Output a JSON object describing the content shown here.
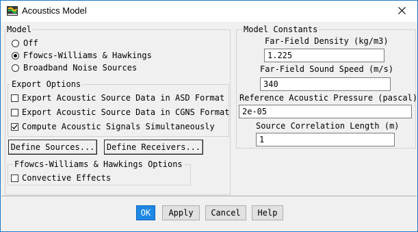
{
  "window": {
    "title": "Acoustics Model",
    "icon": "fluent-app-icon",
    "close_icon": "close-icon"
  },
  "model": {
    "label": "Model",
    "options": [
      {
        "label": "Off",
        "selected": false
      },
      {
        "label": "Ffowcs-Williams & Hawkings",
        "selected": true
      },
      {
        "label": "Broadband Noise Sources",
        "selected": false
      }
    ]
  },
  "export": {
    "label": "Export Options",
    "options": [
      {
        "label": "Export Acoustic Source Data in ASD Format",
        "checked": false
      },
      {
        "label": "Export Acoustic Source Data in CGNS Format",
        "checked": false
      },
      {
        "label": "Compute Acoustic Signals Simultaneously",
        "checked": true
      }
    ]
  },
  "define": {
    "sources_label": "Define Sources...",
    "receivers_label": "Define Receivers..."
  },
  "fwh_options": {
    "label": "Ffowcs-Williams & Hawkings Options",
    "convective_label": "Convective Effects",
    "convective_checked": false
  },
  "constants": {
    "label": "Model Constants",
    "density_label": "Far-Field Density (kg/m3)",
    "density_value": "1.225",
    "speed_label": "Far-Field Sound Speed (m/s)",
    "speed_value": "340",
    "pressure_label": "Reference Acoustic Pressure (pascal)",
    "pressure_value": "2e-05",
    "length_label": "Source Correlation Length (m)",
    "length_value": "1"
  },
  "buttons": {
    "ok": "OK",
    "apply": "Apply",
    "cancel": "Cancel",
    "help": "Help"
  },
  "colors": {
    "accent": "#1e88e5",
    "window_border": "#1979ca"
  }
}
